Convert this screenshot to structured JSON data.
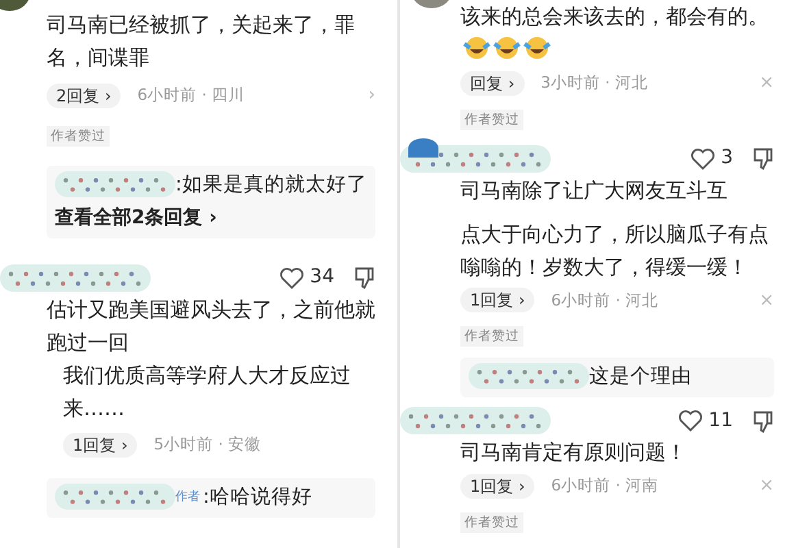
{
  "columns": [
    {
      "blocks": [
        {
          "kind": "comment",
          "avatar": {
            "color": "#4f5a3a"
          },
          "text_lines": [
            "司马南已经被抓了，关起来了，罪名，间谍罪"
          ],
          "replies": "2回复",
          "chevron": "›",
          "time_place": "6小时前 · 四川",
          "action": "›",
          "badge": "作者赞过"
        },
        {
          "kind": "reply_box",
          "text": ":如果是真的就太好了",
          "link": "查看全部2条回复",
          "link_chevron": "›"
        },
        {
          "kind": "comment",
          "likes": "34",
          "text_lines": [
            "估计又跑美国避风头去了，之前他就跑过一回"
          ]
        },
        {
          "kind": "comment",
          "indent": true,
          "text_lines": [
            "我们优质高等学府人大才反应过来……"
          ],
          "replies": "1回复",
          "chevron": "›",
          "time_place": "5小时前 · 安徽"
        },
        {
          "kind": "reply_box",
          "author_tag": "作者",
          "text": ":哈哈说得好"
        }
      ]
    },
    {
      "blocks": [
        {
          "kind": "comment",
          "avatar": {
            "color": "#8a8a80"
          },
          "text_lines": [
            "该来的总会来该去的，都会有的。"
          ],
          "emojis": [
            {
              "kind": "laugh_cry"
            },
            {
              "kind": "laugh_cry"
            },
            {
              "kind": "laugh_cry"
            }
          ],
          "replies": "回复",
          "chevron": "›",
          "time_place": "3小时前 · 河北",
          "action": "×",
          "badge": "作者赞过"
        },
        {
          "kind": "comment",
          "avatar": {
            "color": "#3a7fc4"
          },
          "likes": "3",
          "text_lines": [
            "司马南除了让广大网友互斗互",
            "点大于向心力了，所以脑瓜子有点嗡嗡的！岁数大了，得缓一缓！"
          ],
          "replies": "1回复",
          "chevron": "›",
          "time_place": "6小时前 · 河北",
          "action": "×",
          "badge": "作者赞过"
        },
        {
          "kind": "reply_box",
          "text": "这是个理由"
        },
        {
          "kind": "comment",
          "likes": "11",
          "text_lines": [
            "司马南肯定有原则问题！"
          ],
          "replies": "1回复",
          "chevron": "›",
          "time_place": "6小时前 · 河南",
          "action": "×",
          "badge": "作者赞过"
        }
      ]
    }
  ]
}
